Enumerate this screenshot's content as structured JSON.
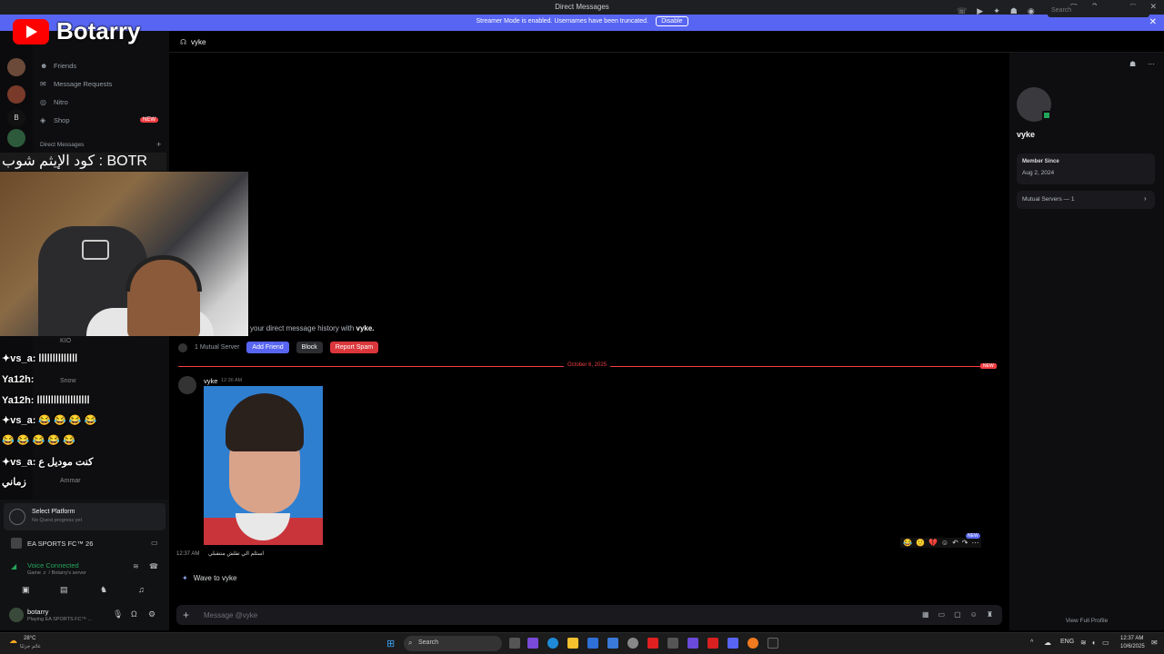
{
  "window": {
    "title": "Direct Messages"
  },
  "banner": {
    "message": "Streamer Mode is enabled. Usernames have been truncated.",
    "button": "Disable"
  },
  "overlay": {
    "brand": "Botarry",
    "code_text": "كود الإيثم شوب : BOTR"
  },
  "sidebar": {
    "items": [
      {
        "label": "Friends"
      },
      {
        "label": "Message Requests"
      },
      {
        "label": "Nitro"
      },
      {
        "label": "Shop",
        "badge": "NEW"
      }
    ],
    "dm_header": "Direct Messages"
  },
  "chat_overlay": [
    {
      "text": "✦vs_a: اااااااااااااا"
    },
    {
      "text": "Ya12h: ااااااااااااااااااا"
    },
    {
      "text": "✦vs_a: 😂 😂 😂 😂"
    },
    {
      "text": "😂 😂 😂 😂 😂"
    },
    {
      "text": "✦vs_a: كنت موديل ع"
    },
    {
      "text": "زماني"
    }
  ],
  "chat_overlay_users": [
    "KIO",
    "Snow",
    "Ammar"
  ],
  "user_panel": {
    "quest_title": "Select Platform",
    "quest_sub": "No Quest progress yet",
    "game": "EA SPORTS FC™ 26",
    "voice_status": "Voice Connected",
    "voice_sub": "Game ♬ / Botarry's server",
    "username": "botarry",
    "user_status": "Playing EA SPORTS FC™ ..."
  },
  "chat": {
    "recipient": "vyke",
    "intro_prefix": "your direct message history with",
    "intro_name": "vyke.",
    "mutual": "1 Mutual Server",
    "buttons": {
      "add_friend": "Add Friend",
      "block": "Block",
      "report": "Report Spam"
    },
    "divider_date": "October 6, 2025",
    "divider_new": "NEW",
    "message": {
      "author": "vyke",
      "time": "12:36 AM"
    },
    "message2": {
      "time": "12:37 AM",
      "text": "اسئلم الي تقلش منتقبلي"
    },
    "hover_new": "NEW",
    "wave": "Wave to vyke",
    "composer_placeholder": "Message @vyke"
  },
  "header": {
    "search_placeholder": "Search"
  },
  "profile": {
    "name": "vyke",
    "member_since_label": "Member Since",
    "member_since": "Aug 2, 2024",
    "mutual_servers": "Mutual Servers — 1",
    "view_full": "View Full Profile"
  },
  "taskbar": {
    "weather_temp": "28°C",
    "weather_sub": "غائم جزئيًا",
    "search": "Search",
    "lang": "ENG",
    "time": "12:37 AM",
    "date": "10/6/2025"
  }
}
